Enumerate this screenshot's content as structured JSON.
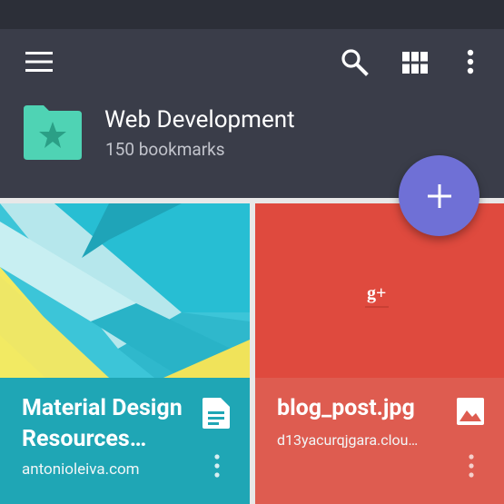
{
  "app": {
    "title": "Web Development",
    "subtitle": "150 bookmarks",
    "icons": [
      "menu-icon",
      "search-icon",
      "grid-view-icon",
      "more-vert-icon",
      "folder-star-icon",
      "add-icon"
    ]
  },
  "colors": {
    "statusbar": "#2c2f38",
    "appbar": "#3a3d49",
    "fab": "#6f70d6",
    "folder": "#4fd3b4",
    "card1_footer": "#1fa6b5",
    "card2_footer": "#de5c50",
    "card2_bg": "#df4a3e"
  },
  "cards": [
    {
      "title": "Material Design Resources…",
      "subtitle": "antonioleiva.com",
      "type_icon": "document-icon"
    },
    {
      "title": "blog_post.jpg",
      "subtitle": "d13yacurqjgara.clou…",
      "type_icon": "image-icon",
      "thumbnail_text": "g+"
    }
  ]
}
